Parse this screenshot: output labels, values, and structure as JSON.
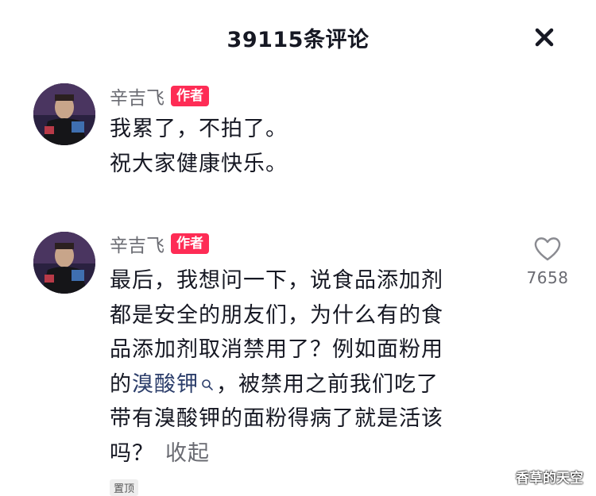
{
  "header": {
    "title": "39115条评论"
  },
  "comments": [
    {
      "author": "辛吉飞",
      "tag": "作者",
      "lines": [
        "我累了，不拍了。",
        "祝大家健康快乐。"
      ]
    },
    {
      "author": "辛吉飞",
      "tag": "作者",
      "lines": [
        "最后，我想问一下，说食品添加剂",
        "都是安全的朋友们，为什么有的食",
        "品添加剂取消禁用了？例如面粉用"
      ],
      "line4_prefix": "的",
      "line4_link": "溴酸钾",
      "line4_suffix": "，被禁用之前我们吃了",
      "line5": "带有溴酸钾的面粉得病了就是活该",
      "line6": "吗？",
      "collapse": "收起",
      "likes": "7658",
      "pinned": "置顶"
    }
  ],
  "watermark": "香草的天空",
  "icons": {
    "close": "close-icon",
    "like": "heart-icon",
    "search": "search-icon"
  }
}
